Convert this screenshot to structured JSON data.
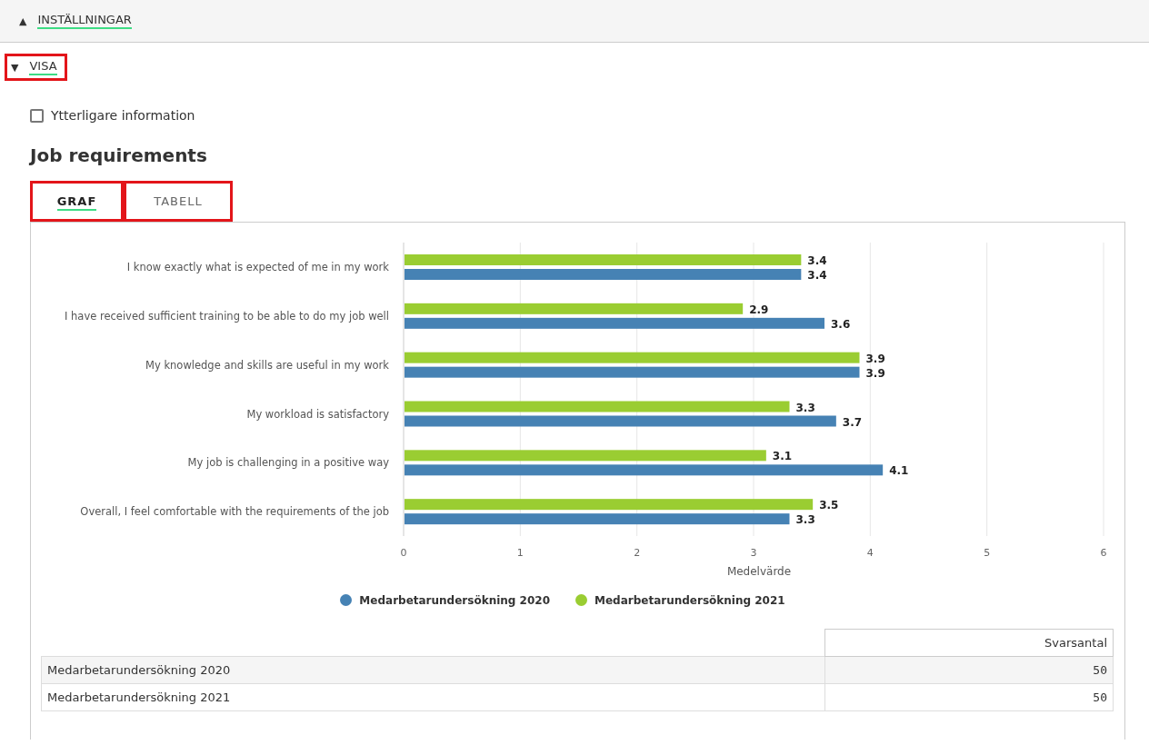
{
  "settings_section": {
    "icon": "▲",
    "label": "INSTÄLLNINGAR"
  },
  "show_section": {
    "icon": "▼",
    "label": "VISA",
    "highlighted": true
  },
  "extra_info": {
    "label": "Ytterligare information",
    "checked": false
  },
  "heading": "Job requirements",
  "tabs": [
    {
      "label": "GRAF",
      "selected": true,
      "highlighted": true
    },
    {
      "label": "TABELL",
      "selected": false,
      "highlighted": true
    }
  ],
  "chart_data": {
    "type": "bar",
    "orientation": "horizontal",
    "xlabel": "Medelvärde",
    "xlim": [
      0,
      6
    ],
    "xticks": [
      0,
      1,
      2,
      3,
      4,
      5,
      6
    ],
    "data_labels": true,
    "grid": true,
    "legend": true,
    "categories": [
      "I know exactly what is expected of me in my work",
      "I have received sufficient training to be able to do my job well",
      "My knowledge and skills are useful in my work",
      "My workload is satisfactory",
      "My job is challenging in a positive way",
      "Overall, I feel comfortable with the requirements of the job"
    ],
    "series": [
      {
        "name": "Medarbetarundersökning 2020",
        "color": "#4682b4",
        "values": [
          3.4,
          3.6,
          3.9,
          3.7,
          4.1,
          3.3
        ]
      },
      {
        "name": "Medarbetarundersökning 2021",
        "color": "#9acd32",
        "values": [
          3.4,
          2.9,
          3.9,
          3.3,
          3.1,
          3.5
        ]
      }
    ]
  },
  "response_table": {
    "columns": [
      "Svarsantal"
    ],
    "rows": [
      {
        "name": "Medarbetarundersökning 2020",
        "count": "50"
      },
      {
        "name": "Medarbetarundersökning 2021",
        "count": "50"
      }
    ]
  }
}
